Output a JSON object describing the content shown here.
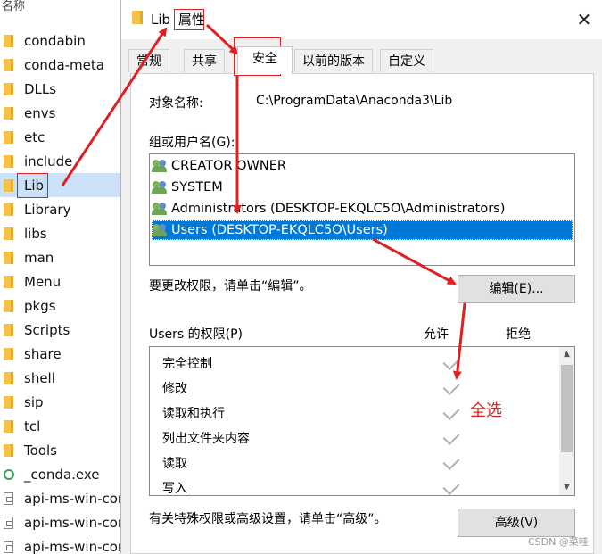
{
  "explorer": {
    "column_header": "名称",
    "items": [
      {
        "label": "condabin",
        "type": "folder"
      },
      {
        "label": "conda-meta",
        "type": "folder"
      },
      {
        "label": "DLLs",
        "type": "folder"
      },
      {
        "label": "envs",
        "type": "folder"
      },
      {
        "label": "etc",
        "type": "folder"
      },
      {
        "label": "include",
        "type": "folder"
      },
      {
        "label": "Lib",
        "type": "folder"
      },
      {
        "label": "Library",
        "type": "folder"
      },
      {
        "label": "libs",
        "type": "folder"
      },
      {
        "label": "man",
        "type": "folder"
      },
      {
        "label": "Menu",
        "type": "folder"
      },
      {
        "label": "pkgs",
        "type": "folder"
      },
      {
        "label": "Scripts",
        "type": "folder"
      },
      {
        "label": "share",
        "type": "folder"
      },
      {
        "label": "shell",
        "type": "folder"
      },
      {
        "label": "sip",
        "type": "folder"
      },
      {
        "label": "tcl",
        "type": "folder"
      },
      {
        "label": "Tools",
        "type": "folder"
      },
      {
        "label": "_conda.exe",
        "type": "exe"
      },
      {
        "label": "api-ms-win-cor",
        "type": "file"
      },
      {
        "label": "api-ms-win-cor",
        "type": "file"
      },
      {
        "label": "api-ms-win-cor",
        "type": "file"
      }
    ]
  },
  "dialog": {
    "title_name": "Lib",
    "title_suffix": "属性",
    "close_glyph": "✕",
    "tabs": [
      "常规",
      "共享",
      "安全",
      "以前的版本",
      "自定义"
    ],
    "object_name_label": "对象名称:",
    "object_name_value": "C:\\ProgramData\\Anaconda3\\Lib",
    "groups_label": "组或用户名(G):",
    "users": [
      "CREATOR OWNER",
      "SYSTEM",
      "Administrators (DESKTOP-EKQLC5O\\Administrators)",
      "Users (DESKTOP-EKQLC5O\\Users)"
    ],
    "change_hint": "要更改权限，请单击“编辑”。",
    "edit_button": "编辑(E)...",
    "perm_label": "Users 的权限(P)",
    "allow_header": "允许",
    "deny_header": "拒绝",
    "permissions": [
      "完全控制",
      "修改",
      "读取和执行",
      "列出文件夹内容",
      "读取",
      "写入"
    ],
    "advanced_hint": "有关特殊权限或高级设置，请单击“高级”。",
    "advanced_button": "高级(V)"
  },
  "annotation": {
    "select_all": "全选",
    "color": "#e02020"
  },
  "watermark": "CSDN @菜哇"
}
